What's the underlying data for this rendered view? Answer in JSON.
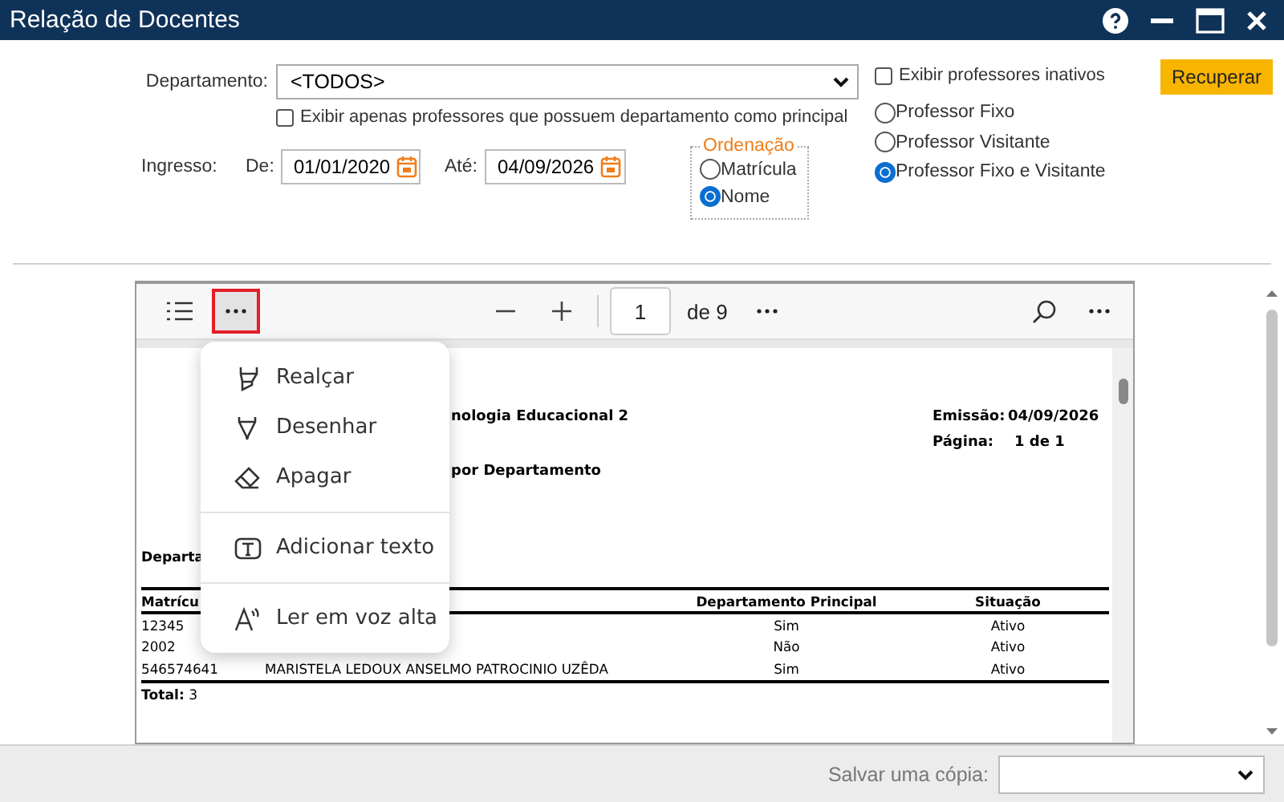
{
  "window": {
    "title": "Relação de Docentes"
  },
  "filters": {
    "department": {
      "label": "Departamento:",
      "value": "<TODOS>"
    },
    "only_principal": {
      "label": "Exibir apenas professores que possuem departamento como principal",
      "checked": false
    },
    "admission": {
      "label": "Ingresso:",
      "from_label": "De:",
      "from": "01/01/2020",
      "to_label": "Até:",
      "to": "04/09/2026"
    },
    "ordering": {
      "legend": "Ordenação",
      "options": [
        {
          "label": "Matrícula",
          "selected": false
        },
        {
          "label": "Nome",
          "selected": true
        }
      ]
    },
    "show_inactive": {
      "label": "Exibir professores inativos",
      "checked": false
    },
    "professor_type": [
      {
        "label": "Professor Fixo",
        "selected": false
      },
      {
        "label": "Professor Visitante",
        "selected": false
      },
      {
        "label": "Professor Fixo e Visitante",
        "selected": true
      }
    ],
    "retrieve_button": "Recuperar"
  },
  "viewer": {
    "toolbar": {
      "more_highlighted": true,
      "page": "1",
      "page_count": "de 9"
    },
    "document": {
      "title": "nologia Educacional 2",
      "subtitle": "por Departamento",
      "emission_label": "Emissão:",
      "emission": "04/09/2026",
      "page_label": "Página:",
      "page": "1 de 1",
      "department_label": "Departa",
      "columns": [
        "Matrícu",
        "Departamento Principal",
        "Situação"
      ],
      "rows": [
        {
          "registration": "12345",
          "principal": "Sim",
          "status": "Ativo"
        },
        {
          "registration": "2002",
          "principal": "Não",
          "status": "Ativo"
        },
        {
          "registration": "546574641",
          "name": "MARISTELA LEDOUX ANSELMO PATROCINIO UZÊDA",
          "principal": "Sim",
          "status": "Ativo"
        }
      ],
      "total": "**Total:** 3"
    },
    "menu": [
      [
        {
          "kind": "highlight",
          "label": "Realçar"
        },
        {
          "kind": "draw",
          "label": "Desenhar"
        },
        {
          "kind": "erase",
          "label": "Apagar"
        }
      ],
      [
        {
          "kind": "text",
          "label": "Adicionar texto"
        }
      ],
      [
        {
          "kind": "read",
          "label": "Ler em voz alta"
        }
      ]
    ]
  },
  "footer": {
    "save_label": "Salvar uma cópia:"
  }
}
